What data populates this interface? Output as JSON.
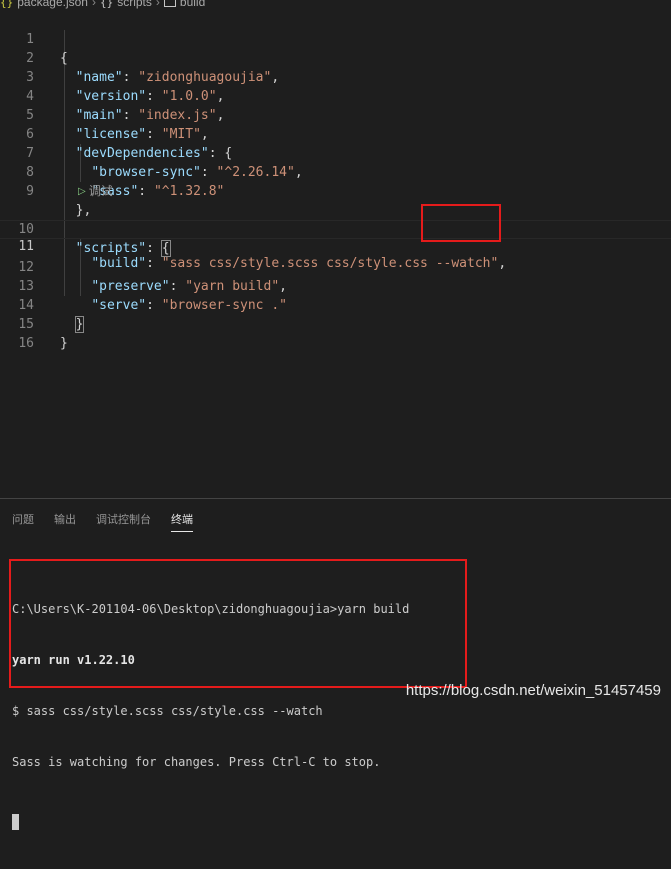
{
  "breadcrumb": {
    "file": "package.json",
    "section": "scripts",
    "item": "build",
    "file_icon": "json-braces-icon",
    "section_icon": "object-braces-icon",
    "item_icon": "box-icon"
  },
  "editor": {
    "lines": [
      {
        "n": "1"
      },
      {
        "n": "2"
      },
      {
        "n": "3"
      },
      {
        "n": "4"
      },
      {
        "n": "5"
      },
      {
        "n": "6"
      },
      {
        "n": "7"
      },
      {
        "n": "8"
      },
      {
        "n": "9"
      },
      {
        "n": "10"
      },
      {
        "n": "11"
      },
      {
        "n": "12"
      },
      {
        "n": "13"
      },
      {
        "n": "14"
      },
      {
        "n": "15"
      },
      {
        "n": "16"
      }
    ],
    "code": {
      "name_key": "\"name\"",
      "name_val": "\"zidonghuagoujia\"",
      "version_key": "\"version\"",
      "version_val": "\"1.0.0\"",
      "main_key": "\"main\"",
      "main_val": "\"index.js\"",
      "license_key": "\"license\"",
      "license_val": "\"MIT\"",
      "devdeps_key": "\"devDependencies\"",
      "browsersync_key": "\"browser-sync\"",
      "browsersync_val": "\"^2.26.14\"",
      "sass_key": "\"sass\"",
      "sass_val": "\"^1.32.8\"",
      "scripts_key": "\"scripts\"",
      "build_key": "\"build\"",
      "build_val": "\"sass css/style.scss css/style.css --watch\"",
      "preserve_key": "\"preserve\"",
      "preserve_val": "\"yarn build\"",
      "serve_key": "\"serve\"",
      "serve_val": "\"browser-sync .\""
    },
    "codelens_label": "调试",
    "current_line": "11"
  },
  "panel": {
    "tabs": [
      "问题",
      "输出",
      "调试控制台",
      "终端"
    ],
    "active_tab": "终端",
    "terminal_lines": [
      "C:\\Users\\K-201104-06\\Desktop\\zidonghuagoujia>yarn build",
      "yarn run v1.22.10",
      "$ sass css/style.scss css/style.css --watch",
      "Sass is watching for changes. Press Ctrl-C to stop."
    ]
  },
  "watermark": "https://blog.csdn.net/weixin_51457459",
  "colors": {
    "background": "#1e1e1e",
    "key": "#9cdcfe",
    "string": "#ce9178",
    "annotation_box": "#e51b1b"
  }
}
